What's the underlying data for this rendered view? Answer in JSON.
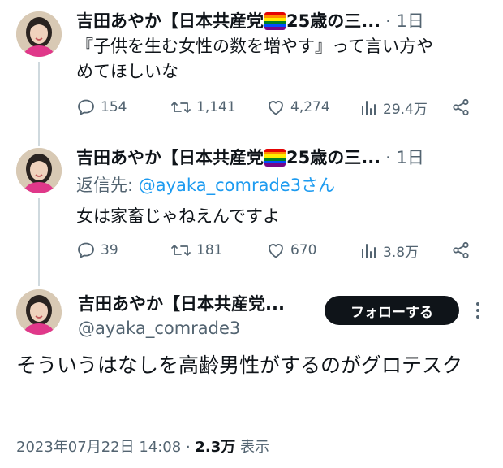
{
  "tweets": [
    {
      "author_name": "吉田あやか【日本共産党",
      "author_name_suffix": "25歳の三...",
      "time": "· 1日",
      "text_line1": "『子供を生む女性の数を増やす』って言い方や",
      "text_line2": "めてほしいな",
      "replies": "154",
      "retweets": "1,141",
      "likes": "4,274",
      "views": "29.4万"
    },
    {
      "author_name": "吉田あやか【日本共産党",
      "author_name_suffix": "25歳の三...",
      "time": "· 1日",
      "reply_to_prefix": "返信先: ",
      "reply_to_handle": "@ayaka_comrade3さん",
      "text_line1": "女は家畜じゃねえんですよ",
      "replies": "39",
      "retweets": "181",
      "likes": "670",
      "views": "3.8万"
    }
  ],
  "focused": {
    "author_name": "吉田あやか【日本共産党...",
    "handle": "@ayaka_comrade3",
    "follow_label": "フォローする",
    "text": "そういうはなしを高齢男性がするのがグロテスク",
    "date": "2023年07月22日 14:08",
    "separator": " · ",
    "views_count": "2.3万",
    "views_label": " 表示"
  },
  "colors": {
    "text": "#0f1419",
    "muted": "#536471",
    "link": "#1d9bf0",
    "follow_bg": "#0f1419",
    "thread_line": "#cfd9de"
  },
  "icons": [
    "reply-icon",
    "retweet-icon",
    "like-icon",
    "views-icon",
    "share-icon",
    "more-icon",
    "rainbow-flag-icon"
  ]
}
